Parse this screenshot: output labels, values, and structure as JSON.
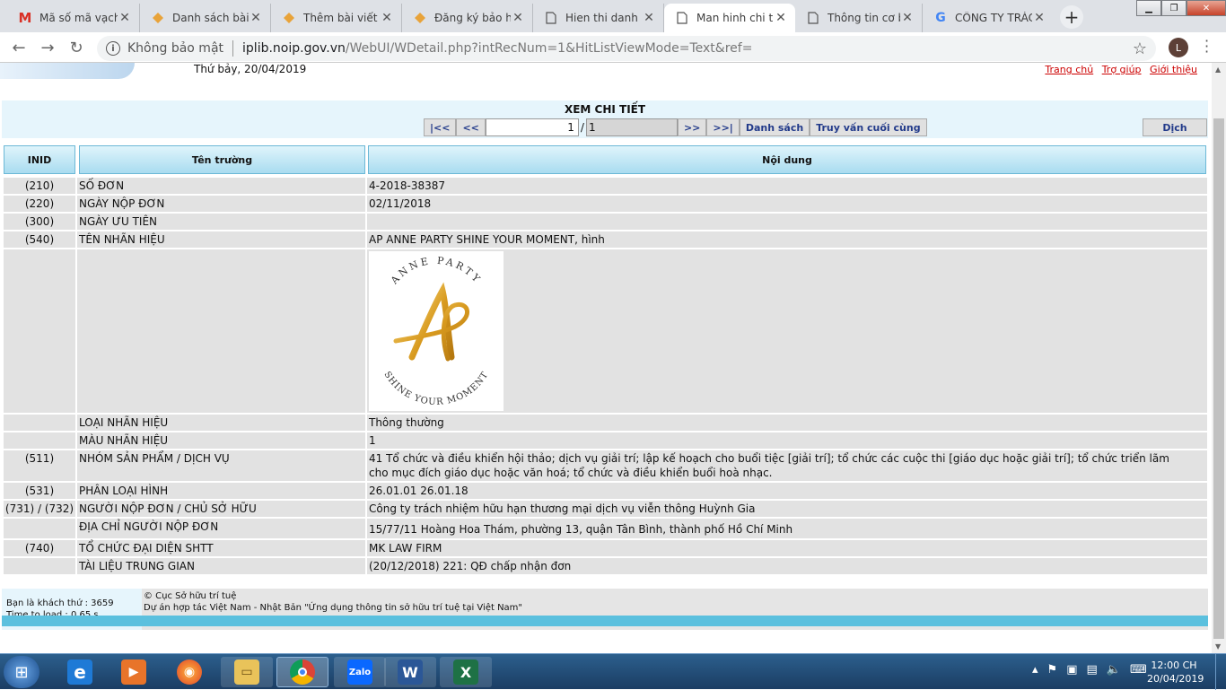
{
  "browser": {
    "tabs": [
      {
        "title": "Mã số mã vạch",
        "icon": "gmail-icon"
      },
      {
        "title": "Danh sách bài v",
        "icon": "site-icon"
      },
      {
        "title": "Thêm bài viết -",
        "icon": "site-icon"
      },
      {
        "title": "Đăng ký bảo hộ",
        "icon": "site-icon"
      },
      {
        "title": "Hien thi danh s",
        "icon": "page-icon"
      },
      {
        "title": "Man hinh chi ti",
        "icon": "page-icon",
        "active": true
      },
      {
        "title": "Thông tin cơ bả",
        "icon": "page-icon"
      },
      {
        "title": "CÔNG TY TRÁC",
        "icon": "google-icon"
      }
    ],
    "security_label": "Không bảo mật",
    "url_host": "iplib.noip.gov.vn",
    "url_path": "/WebUI/WDetail.php?intRecNum=1&HitListViewMode=Text&ref=",
    "profile_initial": "L"
  },
  "header": {
    "date": "Thứ bảy, 20/04/2019",
    "links": [
      "Trang chủ",
      "Trợ giúp",
      "Giới thiệu"
    ]
  },
  "detail": {
    "heading": "XEM CHI TIẾT",
    "first": "|<<",
    "prev": "<<",
    "current_record": "1",
    "slash": "/",
    "total_records": "1",
    "next": ">>",
    "last": ">>|",
    "list_button": "Danh sách",
    "last_query_button": "Truy vấn cuối cùng",
    "translate_button": "Dịch"
  },
  "table": {
    "headers": [
      "INID",
      "Tên trường",
      "Nội dung"
    ],
    "rows": [
      {
        "inid": "(210)",
        "field": "SỐ ĐƠN",
        "value": "4-2018-38387"
      },
      {
        "inid": "(220)",
        "field": "NGÀY NỘP ĐƠN",
        "value": "02/11/2018"
      },
      {
        "inid": "(300)",
        "field": "NGÀY ƯU TIÊN",
        "value": ""
      },
      {
        "inid": "(540)",
        "field": "TÊN NHÃN HIỆU",
        "value": "AP ANNE PARTY SHINE YOUR MOMENT, hình"
      },
      {
        "inid": "",
        "field": "LOẠI NHÃN HIỆU",
        "value": "Thông thường"
      },
      {
        "inid": "",
        "field": "MÀU NHÃN HIỆU",
        "value": "1"
      },
      {
        "inid": "(511)",
        "field": "NHÓM SẢN PHẨM / DỊCH VỤ",
        "value": "41 Tổ chức và điều khiển hội thảo; dịch vụ giải trí; lập kế hoạch cho buổi tiệc [giải trí]; tổ chức các cuộc thi [giáo dục hoặc giải trí]; tổ chức triển lãm cho mục đích giáo dục hoặc văn hoá; tổ chức và điều khiển buổi hoà nhạc."
      },
      {
        "inid": "(531)",
        "field": "PHÂN LOẠI HÌNH",
        "value": "26.01.01 26.01.18"
      },
      {
        "inid": "(731) / (732)",
        "field": "NGƯỜI NỘP ĐƠN / CHỦ SỞ HỮU",
        "value": "Công ty trách nhiệm hữu hạn thương mại dịch vụ viễn thông Huỳnh Gia"
      },
      {
        "inid": "",
        "field": "ĐỊA CHỈ NGƯỜI NỘP ĐƠN",
        "value": "15/77/11 Hoàng Hoa Thám, phường 13, quận Tân Bình, thành phố Hồ Chí Minh"
      },
      {
        "inid": "(740)",
        "field": "TỔ CHỨC ĐẠI DIỆN SHTT",
        "value": "MK LAW FIRM"
      },
      {
        "inid": "",
        "field": "TÀI LIỆU TRUNG GIAN",
        "value": "(20/12/2018) 221: QĐ chấp nhận đơn"
      }
    ],
    "logo_top_text": "ANNE PARTY",
    "logo_bottom_text": "SHINE YOUR MOMENT",
    "logo_letters": "AP"
  },
  "footer": {
    "visitor": "Bạn là khách thứ : 3659",
    "load_time": "Time to load : 0.65 s",
    "copyright": "© Cục Sở hữu trí tuệ",
    "project": "Dự án hợp tác Việt Nam - Nhật Bản \"Ứng dụng thông tin sở hữu trí tuệ tại Việt Nam\""
  },
  "taskbar": {
    "time": "12:00 CH",
    "date": "20/04/2019",
    "apps": [
      "internet-explorer-icon",
      "media-player-icon",
      "firefox-icon",
      "file-explorer-icon",
      "chrome-icon",
      "zalo-icon",
      "word-icon",
      "excel-icon"
    ],
    "zalo_label": "Zalo",
    "word_label": "W",
    "excel_label": "X"
  },
  "colors": {
    "header_cell_top": "#dff4fb",
    "header_cell_bottom": "#a9dcf0",
    "row_bg": "#e2e2e2",
    "link_red": "#cc0000",
    "button_text": "#223a8a"
  }
}
